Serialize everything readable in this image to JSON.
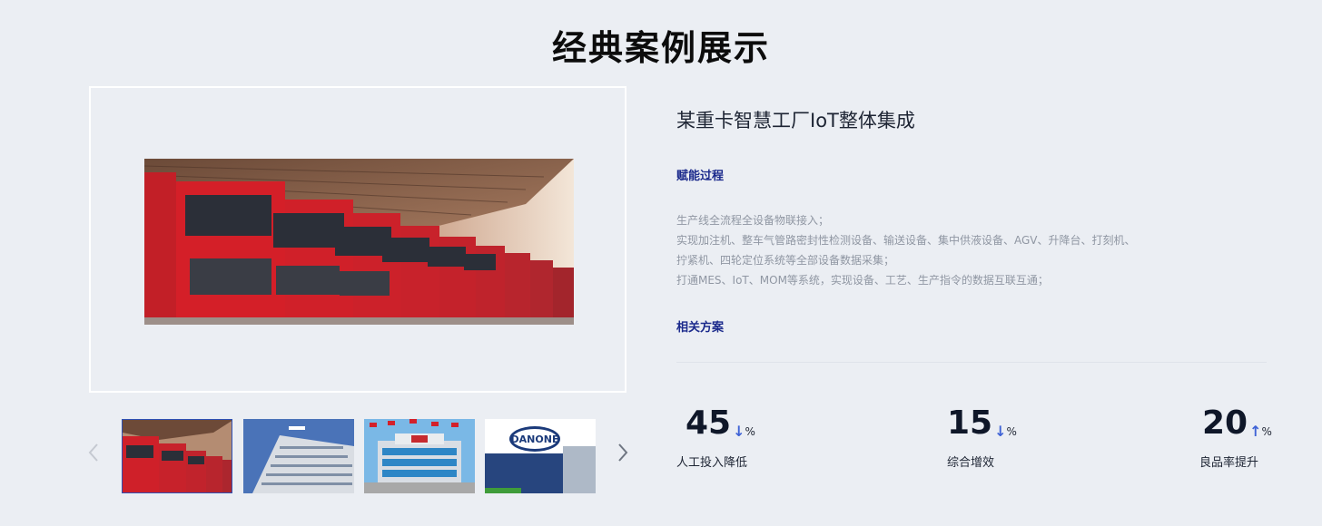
{
  "page": {
    "title": "经典案例展示"
  },
  "case": {
    "title": "某重卡智慧工厂IoT整体集成",
    "process_label": "赋能过程",
    "description": [
      "生产线全流程全设备物联接入；",
      "实现加注机、整车气管路密封性检测设备、输送设备、集中供液设备、AGV、升降台、打刻机、拧紧机、四轮定位系统等全部设备数据采集；",
      "打通MES、IoT、MOM等系统，实现设备、工艺、生产指令的数据互联互通；"
    ],
    "solution_label": "相关方案"
  },
  "stats": [
    {
      "value": "45",
      "direction": "↓",
      "unit": "%",
      "label": "人工投入降低"
    },
    {
      "value": "15",
      "direction": "↓",
      "unit": "%",
      "label": "综合增效"
    },
    {
      "value": "20",
      "direction": "↑",
      "unit": "%",
      "label": "良品率提升"
    }
  ],
  "gallery": {
    "thumbnails": [
      {
        "icon": "trucks-photo",
        "active": true
      },
      {
        "icon": "office-building-photo",
        "active": false
      },
      {
        "icon": "factory-flags-photo",
        "active": false
      },
      {
        "icon": "danone-sign-photo",
        "active": false,
        "sign_text": "DANONE"
      }
    ]
  },
  "icons": {
    "prev": "chevron-left-icon",
    "next": "chevron-right-icon"
  },
  "colors": {
    "accent": "#1b2a8c",
    "arrow": "#3f63d6",
    "background": "#ebeef3"
  }
}
